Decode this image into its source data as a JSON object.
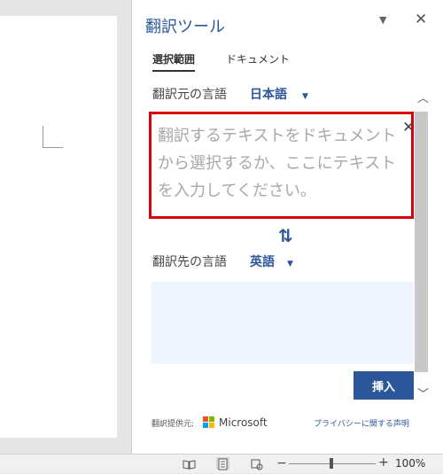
{
  "pane": {
    "title": "翻訳ツール",
    "menu_icon": "dropdown-caret-icon",
    "close_label": "✕"
  },
  "tabs": [
    {
      "label": "選択範囲",
      "selected": true
    },
    {
      "label": "ドキュメント",
      "selected": false
    }
  ],
  "source": {
    "label": "翻訳元の言語",
    "language": "日本語",
    "placeholder": "翻訳するテキストをドキュメントから選択するか、ここにテキストを入力してください。"
  },
  "target": {
    "label": "翻訳先の言語",
    "language": "英語",
    "text": ""
  },
  "insert_label": "挿入",
  "footer": {
    "provider_label": "翻訳提供元:",
    "provider_name": "Microsoft",
    "privacy_link": "プライバシーに関する声明"
  },
  "status_bar": {
    "zoom": "100%"
  },
  "colors": {
    "accent": "#2b579a",
    "highlight": "#d9000d",
    "target_bg": "#eef5fc"
  }
}
